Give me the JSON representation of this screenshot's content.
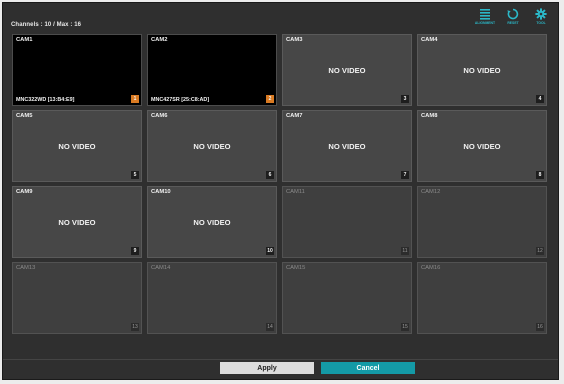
{
  "header": {
    "channels_text": "Channels : 10 / Max : 16"
  },
  "toolbar": {
    "accent_color": "#2bb8c8",
    "items": [
      {
        "label": "ALIGNMENT",
        "icon": "alignment-icon"
      },
      {
        "label": "RESET",
        "icon": "reset-icon"
      },
      {
        "label": "TOOL",
        "icon": "tool-icon"
      }
    ]
  },
  "cameras": [
    {
      "name": "CAM1",
      "model": "MNC322WD [13:B4:E9]",
      "number": "1",
      "state": "live"
    },
    {
      "name": "CAM2",
      "model": "MNC427SR [25:C8:AD]",
      "number": "2",
      "state": "live"
    },
    {
      "name": "CAM3",
      "status": "NO VIDEO",
      "number": "3",
      "state": "novideo"
    },
    {
      "name": "CAM4",
      "status": "NO VIDEO",
      "number": "4",
      "state": "novideo"
    },
    {
      "name": "CAM5",
      "status": "NO VIDEO",
      "number": "5",
      "state": "novideo"
    },
    {
      "name": "CAM6",
      "status": "NO VIDEO",
      "number": "6",
      "state": "novideo"
    },
    {
      "name": "CAM7",
      "status": "NO VIDEO",
      "number": "7",
      "state": "novideo"
    },
    {
      "name": "CAM8",
      "status": "NO VIDEO",
      "number": "8",
      "state": "novideo"
    },
    {
      "name": "CAM9",
      "status": "NO VIDEO",
      "number": "9",
      "state": "novideo"
    },
    {
      "name": "CAM10",
      "status": "NO VIDEO",
      "number": "10",
      "state": "novideo"
    },
    {
      "name": "CAM11",
      "number": "11",
      "state": "disabled"
    },
    {
      "name": "CAM12",
      "number": "12",
      "state": "disabled"
    },
    {
      "name": "CAM13",
      "number": "13",
      "state": "disabled"
    },
    {
      "name": "CAM14",
      "number": "14",
      "state": "disabled"
    },
    {
      "name": "CAM15",
      "number": "15",
      "state": "disabled"
    },
    {
      "name": "CAM16",
      "number": "16",
      "state": "disabled"
    }
  ],
  "footer": {
    "apply_label": "Apply",
    "cancel_label": "Cancel",
    "cancel_color": "#149aa6",
    "live_badge_color": "#d97a22"
  }
}
